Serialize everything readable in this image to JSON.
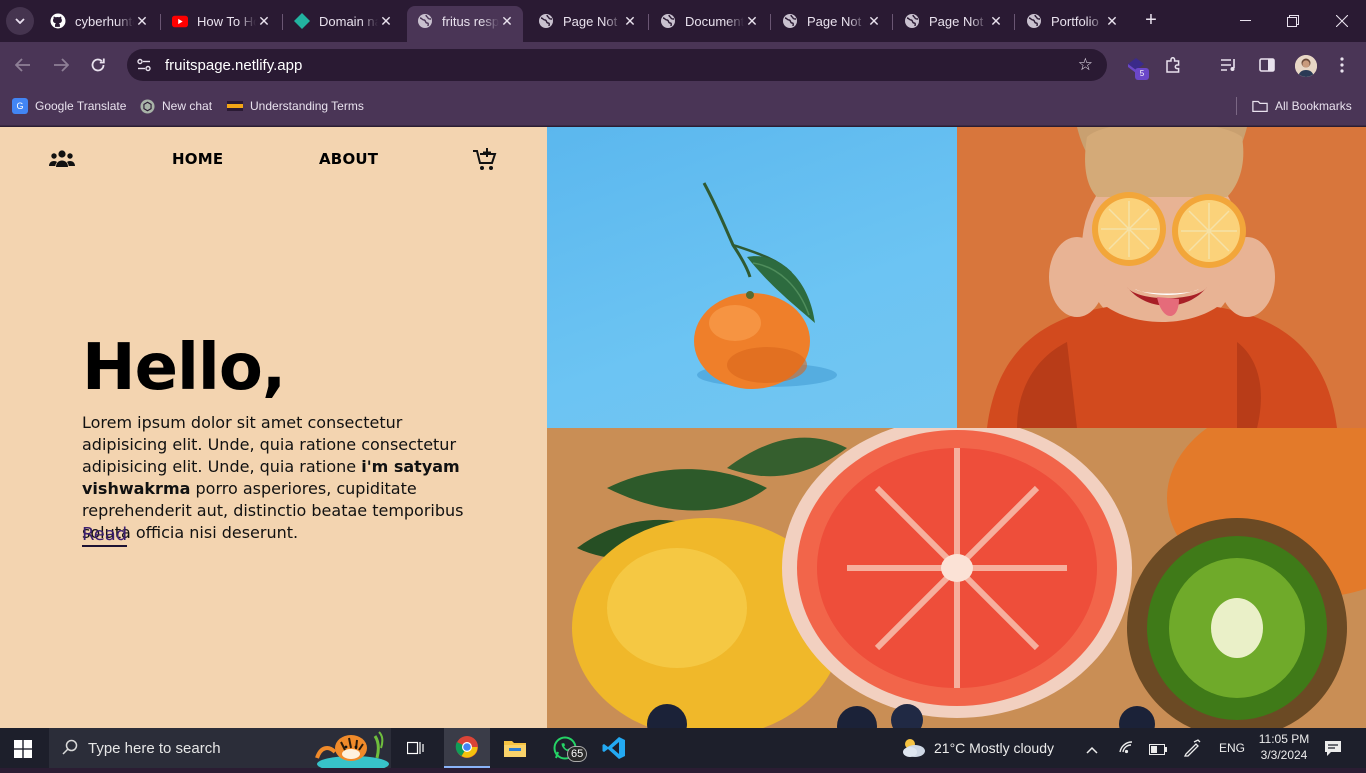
{
  "browser": {
    "tabs": [
      {
        "title": "cyberhunter",
        "icon": "github-icon"
      },
      {
        "title": "How To Host",
        "icon": "youtube-icon"
      },
      {
        "title": "Domain name",
        "icon": "diamond-icon"
      },
      {
        "title": "fritus responsive",
        "icon": "globe-icon",
        "active": true
      },
      {
        "title": "Page Not Found",
        "icon": "globe-icon"
      },
      {
        "title": "Document",
        "icon": "globe-icon"
      },
      {
        "title": "Page Not Found",
        "icon": "globe-icon"
      },
      {
        "title": "Page Not Found",
        "icon": "globe-icon"
      },
      {
        "title": "Portfolio",
        "icon": "globe-icon"
      }
    ],
    "url": "fruitspage.netlify.app",
    "extension_badge": "5",
    "bookmarks": [
      {
        "label": "Google Translate",
        "icon": "google-translate-icon"
      },
      {
        "label": "New chat",
        "icon": "chatgpt-icon"
      },
      {
        "label": "Understanding Terms",
        "icon": "bookmark-favicon-icon"
      }
    ],
    "all_bookmarks_label": "All Bookmarks"
  },
  "site": {
    "nav": {
      "home": "HOME",
      "about": "ABOUT"
    },
    "hero": {
      "heading": "Hello,",
      "text_before": "Lorem ipsum dolor sit amet consectetur adipisicing elit. Unde, quia ratione consectetur adipisicing elit. Unde, quia ratione ",
      "text_bold": "i'm satyam vishwakrma",
      "text_after": " porro asperiores, cupiditate reprehenderit aut, distinctio beatae temporibus soluta officia nisi deserunt.",
      "read_link": "Read"
    },
    "colors": {
      "background": "#f3d4b0",
      "link": "#3c1f6e"
    }
  },
  "taskbar": {
    "search_placeholder": "Type here to search",
    "whatsapp_badge": "65",
    "weather": "21°C  Mostly cloudy",
    "language": "ENG",
    "time": "11:05 PM",
    "date": "3/3/2024"
  }
}
